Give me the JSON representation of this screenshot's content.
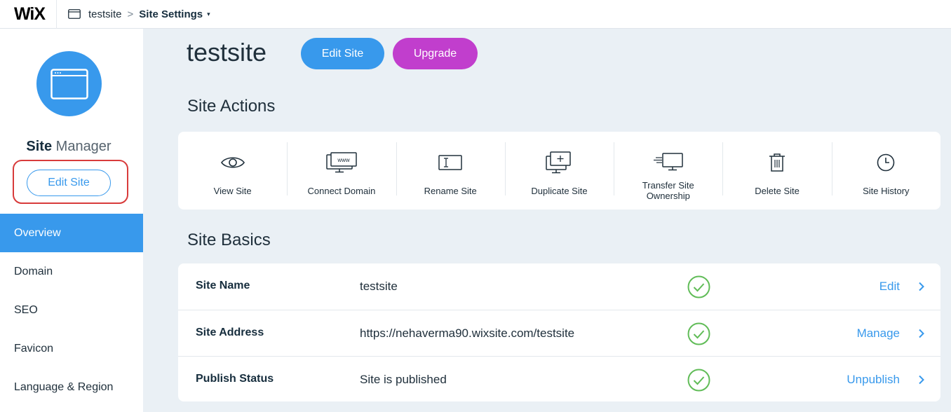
{
  "topbar": {
    "logo": "WiX",
    "site_name": "testsite",
    "separator": ">",
    "current_page": "Site Settings",
    "caret": "▾"
  },
  "sidebar": {
    "title_bold": "Site",
    "title_light": "Manager",
    "edit_button": "Edit Site",
    "nav": [
      {
        "label": "Overview",
        "active": true
      },
      {
        "label": "Domain",
        "active": false
      },
      {
        "label": "SEO",
        "active": false
      },
      {
        "label": "Favicon",
        "active": false
      },
      {
        "label": "Language & Region",
        "active": false
      }
    ]
  },
  "main": {
    "site_title": "testsite",
    "edit_button": "Edit Site",
    "upgrade_button": "Upgrade",
    "actions_heading": "Site Actions",
    "actions": [
      {
        "label": "View Site",
        "icon": "eye-icon"
      },
      {
        "label": "Connect Domain",
        "icon": "www-monitor-icon"
      },
      {
        "label": "Rename Site",
        "icon": "text-cursor-icon"
      },
      {
        "label": "Duplicate Site",
        "icon": "duplicate-monitor-icon"
      },
      {
        "label": "Transfer Site Ownership",
        "icon": "transfer-monitor-icon"
      },
      {
        "label": "Delete Site",
        "icon": "trash-icon"
      },
      {
        "label": "Site History",
        "icon": "clock-icon"
      }
    ],
    "basics_heading": "Site Basics",
    "basics": [
      {
        "label": "Site Name",
        "value": "testsite",
        "link": "Edit"
      },
      {
        "label": "Site Address",
        "value": "https://nehaverma90.wixsite.com/testsite",
        "link": "Manage"
      },
      {
        "label": "Publish Status",
        "value": "Site is published",
        "link": "Unpublish"
      }
    ]
  },
  "colors": {
    "accent": "#3899ec",
    "upgrade": "#c13ecd",
    "check": "#60bc57",
    "highlight": "#d83b3b",
    "background": "#eaf0f5"
  }
}
